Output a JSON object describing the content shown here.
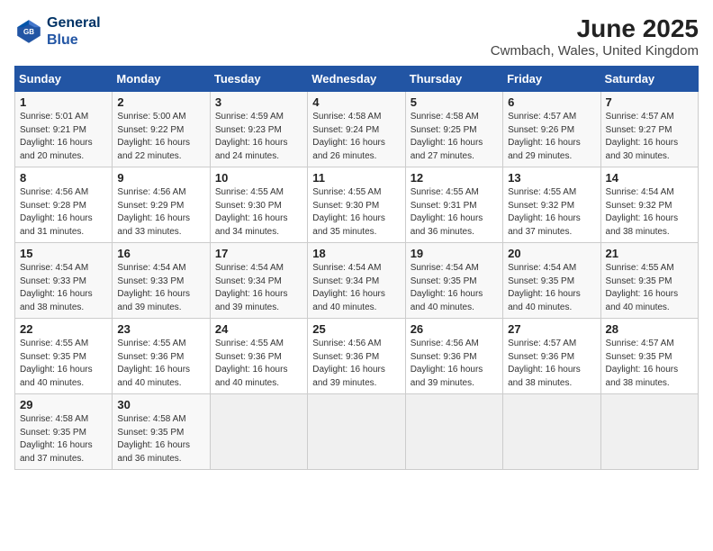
{
  "header": {
    "logo_line1": "General",
    "logo_line2": "Blue",
    "title": "June 2025",
    "subtitle": "Cwmbach, Wales, United Kingdom"
  },
  "days_of_week": [
    "Sunday",
    "Monday",
    "Tuesday",
    "Wednesday",
    "Thursday",
    "Friday",
    "Saturday"
  ],
  "weeks": [
    [
      {
        "day": "1",
        "detail": "Sunrise: 5:01 AM\nSunset: 9:21 PM\nDaylight: 16 hours\nand 20 minutes."
      },
      {
        "day": "2",
        "detail": "Sunrise: 5:00 AM\nSunset: 9:22 PM\nDaylight: 16 hours\nand 22 minutes."
      },
      {
        "day": "3",
        "detail": "Sunrise: 4:59 AM\nSunset: 9:23 PM\nDaylight: 16 hours\nand 24 minutes."
      },
      {
        "day": "4",
        "detail": "Sunrise: 4:58 AM\nSunset: 9:24 PM\nDaylight: 16 hours\nand 26 minutes."
      },
      {
        "day": "5",
        "detail": "Sunrise: 4:58 AM\nSunset: 9:25 PM\nDaylight: 16 hours\nand 27 minutes."
      },
      {
        "day": "6",
        "detail": "Sunrise: 4:57 AM\nSunset: 9:26 PM\nDaylight: 16 hours\nand 29 minutes."
      },
      {
        "day": "7",
        "detail": "Sunrise: 4:57 AM\nSunset: 9:27 PM\nDaylight: 16 hours\nand 30 minutes."
      }
    ],
    [
      {
        "day": "8",
        "detail": "Sunrise: 4:56 AM\nSunset: 9:28 PM\nDaylight: 16 hours\nand 31 minutes."
      },
      {
        "day": "9",
        "detail": "Sunrise: 4:56 AM\nSunset: 9:29 PM\nDaylight: 16 hours\nand 33 minutes."
      },
      {
        "day": "10",
        "detail": "Sunrise: 4:55 AM\nSunset: 9:30 PM\nDaylight: 16 hours\nand 34 minutes."
      },
      {
        "day": "11",
        "detail": "Sunrise: 4:55 AM\nSunset: 9:30 PM\nDaylight: 16 hours\nand 35 minutes."
      },
      {
        "day": "12",
        "detail": "Sunrise: 4:55 AM\nSunset: 9:31 PM\nDaylight: 16 hours\nand 36 minutes."
      },
      {
        "day": "13",
        "detail": "Sunrise: 4:55 AM\nSunset: 9:32 PM\nDaylight: 16 hours\nand 37 minutes."
      },
      {
        "day": "14",
        "detail": "Sunrise: 4:54 AM\nSunset: 9:32 PM\nDaylight: 16 hours\nand 38 minutes."
      }
    ],
    [
      {
        "day": "15",
        "detail": "Sunrise: 4:54 AM\nSunset: 9:33 PM\nDaylight: 16 hours\nand 38 minutes."
      },
      {
        "day": "16",
        "detail": "Sunrise: 4:54 AM\nSunset: 9:33 PM\nDaylight: 16 hours\nand 39 minutes."
      },
      {
        "day": "17",
        "detail": "Sunrise: 4:54 AM\nSunset: 9:34 PM\nDaylight: 16 hours\nand 39 minutes."
      },
      {
        "day": "18",
        "detail": "Sunrise: 4:54 AM\nSunset: 9:34 PM\nDaylight: 16 hours\nand 40 minutes."
      },
      {
        "day": "19",
        "detail": "Sunrise: 4:54 AM\nSunset: 9:35 PM\nDaylight: 16 hours\nand 40 minutes."
      },
      {
        "day": "20",
        "detail": "Sunrise: 4:54 AM\nSunset: 9:35 PM\nDaylight: 16 hours\nand 40 minutes."
      },
      {
        "day": "21",
        "detail": "Sunrise: 4:55 AM\nSunset: 9:35 PM\nDaylight: 16 hours\nand 40 minutes."
      }
    ],
    [
      {
        "day": "22",
        "detail": "Sunrise: 4:55 AM\nSunset: 9:35 PM\nDaylight: 16 hours\nand 40 minutes."
      },
      {
        "day": "23",
        "detail": "Sunrise: 4:55 AM\nSunset: 9:36 PM\nDaylight: 16 hours\nand 40 minutes."
      },
      {
        "day": "24",
        "detail": "Sunrise: 4:55 AM\nSunset: 9:36 PM\nDaylight: 16 hours\nand 40 minutes."
      },
      {
        "day": "25",
        "detail": "Sunrise: 4:56 AM\nSunset: 9:36 PM\nDaylight: 16 hours\nand 39 minutes."
      },
      {
        "day": "26",
        "detail": "Sunrise: 4:56 AM\nSunset: 9:36 PM\nDaylight: 16 hours\nand 39 minutes."
      },
      {
        "day": "27",
        "detail": "Sunrise: 4:57 AM\nSunset: 9:36 PM\nDaylight: 16 hours\nand 38 minutes."
      },
      {
        "day": "28",
        "detail": "Sunrise: 4:57 AM\nSunset: 9:35 PM\nDaylight: 16 hours\nand 38 minutes."
      }
    ],
    [
      {
        "day": "29",
        "detail": "Sunrise: 4:58 AM\nSunset: 9:35 PM\nDaylight: 16 hours\nand 37 minutes."
      },
      {
        "day": "30",
        "detail": "Sunrise: 4:58 AM\nSunset: 9:35 PM\nDaylight: 16 hours\nand 36 minutes."
      },
      {
        "day": "",
        "detail": ""
      },
      {
        "day": "",
        "detail": ""
      },
      {
        "day": "",
        "detail": ""
      },
      {
        "day": "",
        "detail": ""
      },
      {
        "day": "",
        "detail": ""
      }
    ]
  ]
}
